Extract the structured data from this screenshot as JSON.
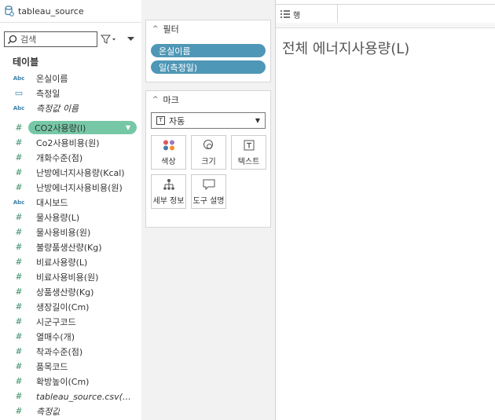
{
  "data_source": {
    "name": "tableau_source"
  },
  "search": {
    "placeholder": "검색"
  },
  "tables_section": {
    "title": "테이블"
  },
  "dimensions": [
    {
      "icon": "Abc",
      "label": "온실이름"
    },
    {
      "icon": "calendar",
      "label": "측정일"
    },
    {
      "icon": "Abc",
      "label": "측정값 이름"
    }
  ],
  "measures": [
    {
      "icon": "#",
      "label": "CO2사용량(l)"
    },
    {
      "icon": "#",
      "label": "Co2사용비용(원)"
    },
    {
      "icon": "#",
      "label": "개화수준(점)"
    },
    {
      "icon": "#",
      "label": "난방에너지사용량(Kcal)"
    },
    {
      "icon": "#",
      "label": "난방에너지사용비용(원)"
    },
    {
      "icon": "Abc",
      "label": "대시보드"
    },
    {
      "icon": "#",
      "label": "물사용량(L)"
    },
    {
      "icon": "#",
      "label": "물사용비용(원)"
    },
    {
      "icon": "#",
      "label": "불량품생산량(Kg)"
    },
    {
      "icon": "#",
      "label": "비료사용량(L)"
    },
    {
      "icon": "#",
      "label": "비료사용비용(원)"
    },
    {
      "icon": "#",
      "label": "상품생산량(Kg)"
    },
    {
      "icon": "#",
      "label": "생장길이(Cm)"
    },
    {
      "icon": "#",
      "label": "시군구코드"
    },
    {
      "icon": "#",
      "label": "열매수(개)"
    },
    {
      "icon": "#",
      "label": "착과수준(점)"
    },
    {
      "icon": "#",
      "label": "품목코드"
    },
    {
      "icon": "#",
      "label": "확방높이(Cm)"
    },
    {
      "icon": "#",
      "label": "tableau_source.csv(카..."
    },
    {
      "icon": "#",
      "label": "측정값"
    }
  ],
  "filters": {
    "title": "필터",
    "pills": [
      "온실이름",
      "일(측정일)"
    ]
  },
  "marks": {
    "title": "마크",
    "type_value": "자동",
    "buttons": [
      "색상",
      "크기",
      "텍스트",
      "세부 정보",
      "도구 설명"
    ]
  },
  "rows_shelf": {
    "label": "행"
  },
  "view": {
    "title": "전체 에너지사용량(L)"
  },
  "colors": {
    "measure_green": "#76c7a6",
    "filter_blue": "#4f97b6"
  }
}
